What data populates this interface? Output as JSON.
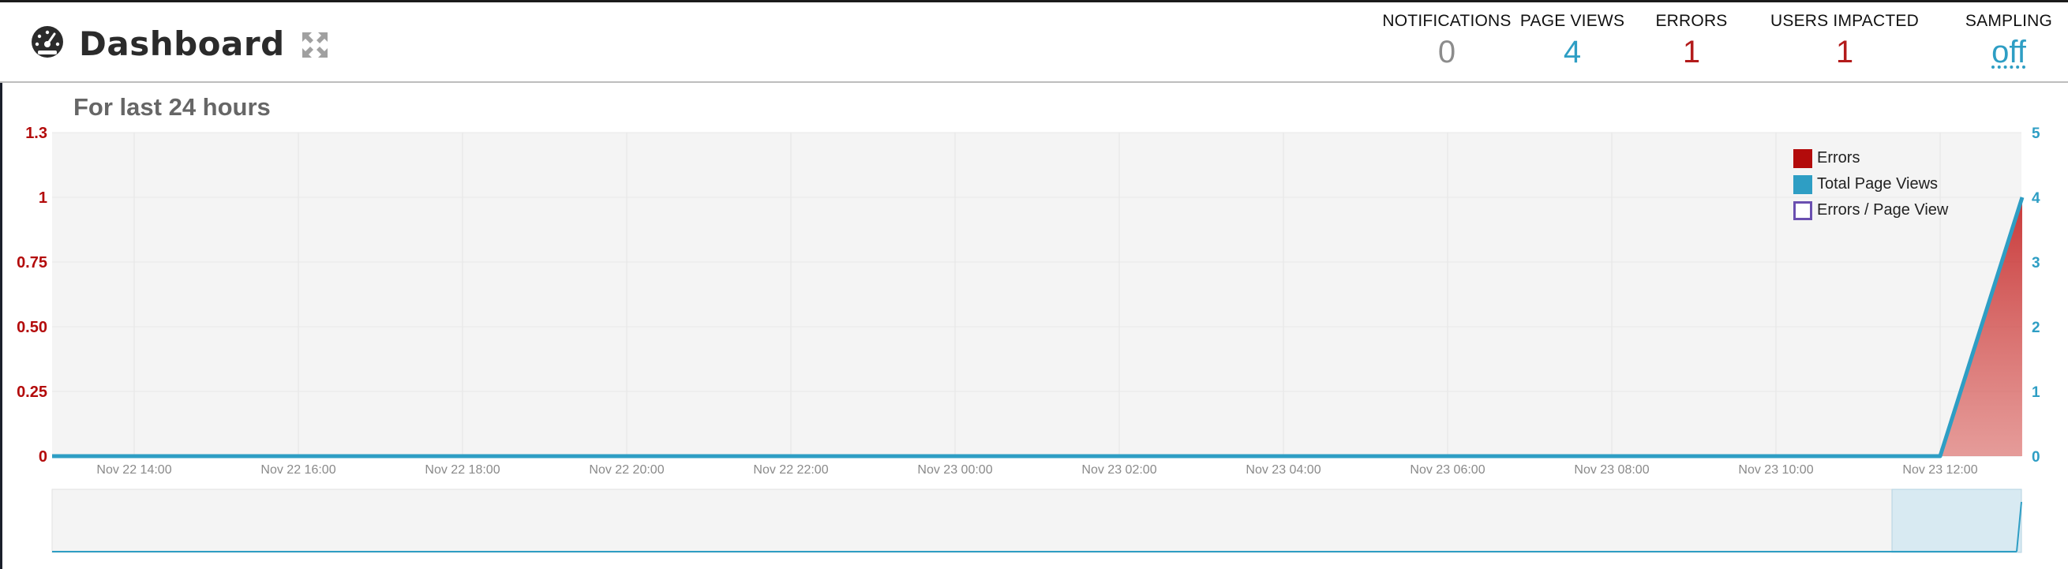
{
  "header": {
    "title": "Dashboard",
    "stats": [
      {
        "label": "NOTIFICATIONS",
        "value": "0",
        "color": "#8c8c8c"
      },
      {
        "label": "PAGE VIEWS",
        "value": "4",
        "color": "#2e9ec4"
      },
      {
        "label": "ERRORS",
        "value": "1",
        "color": "#b31b1b"
      },
      {
        "label": "USERS IMPACTED",
        "value": "1",
        "color": "#b31b1b"
      },
      {
        "label": "SAMPLING",
        "value": "off",
        "color": "#2e9ec4"
      }
    ]
  },
  "subtitle": "For last 24 hours",
  "colors": {
    "errors": "#b30b0b",
    "page_views": "#2e9ec4",
    "errors_per_view": "#6a4fb0",
    "plot_bg": "#f4f4f4",
    "navigator_selection": "#d8eaf2"
  },
  "chart_data": {
    "type": "area",
    "x": [
      "Nov 22 14:00",
      "Nov 22 16:00",
      "Nov 22 18:00",
      "Nov 22 20:00",
      "Nov 22 22:00",
      "Nov 23 00:00",
      "Nov 23 02:00",
      "Nov 23 04:00",
      "Nov 23 06:00",
      "Nov 23 08:00",
      "Nov 23 10:00",
      "Nov 23 12:00"
    ],
    "y_left": {
      "ticks": [
        "0",
        "0.25",
        "0.50",
        "0.75",
        "1",
        "1.3"
      ],
      "range": [
        0,
        1.25
      ]
    },
    "y_right": {
      "ticks": [
        "0",
        "1",
        "2",
        "3",
        "4",
        "5"
      ],
      "range": [
        0,
        5
      ]
    },
    "series": [
      {
        "name": "Errors",
        "axis": "left",
        "points": [
          [
            "Nov 22 13:00",
            0
          ],
          [
            "Nov 23 12:00",
            0
          ],
          [
            "Nov 23 13:00",
            1
          ]
        ]
      },
      {
        "name": "Total Page Views",
        "axis": "right",
        "points": [
          [
            "Nov 22 13:00",
            0
          ],
          [
            "Nov 23 12:00",
            0
          ],
          [
            "Nov 23 13:00",
            4
          ]
        ]
      },
      {
        "name": "Errors / Page View",
        "axis": "left",
        "points": []
      }
    ],
    "legend": "top-right",
    "grid": true
  }
}
